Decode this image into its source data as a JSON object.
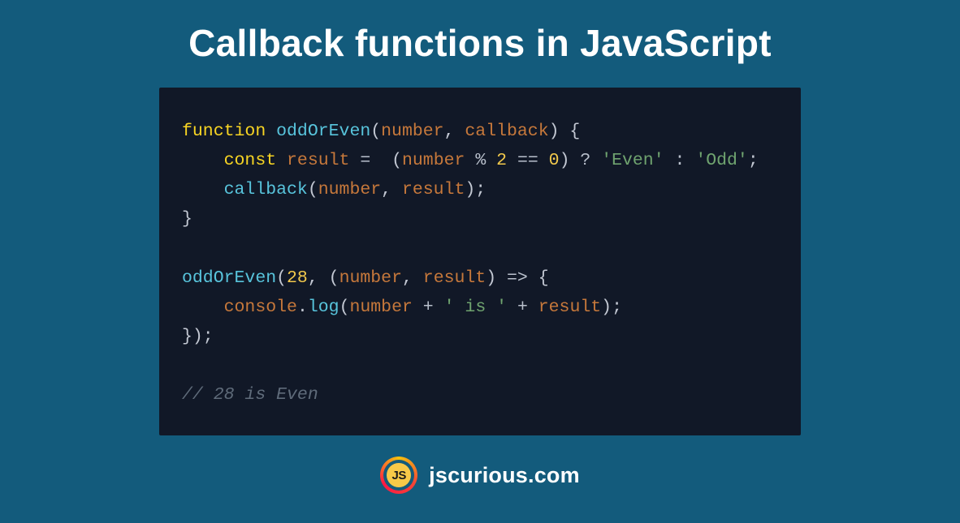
{
  "title": "Callback functions in JavaScript",
  "logo_text": "JS",
  "site": "jscurious.com",
  "code": {
    "kw_function": "function",
    "fn_name": "oddOrEven",
    "param_number": "number",
    "param_callback": "callback",
    "kw_const": "const",
    "var_result": "result",
    "op_mod": "%",
    "num_2": "2",
    "op_eq": "==",
    "num_0": "0",
    "str_even": "'Even'",
    "str_odd": "'Odd'",
    "call_callback": "callback",
    "call_oddOrEven": "oddOrEven",
    "num_28": "28",
    "arrow": "=>",
    "obj_console": "console",
    "fn_log": "log",
    "str_is": "' is '",
    "comment": "// 28 is Even"
  }
}
